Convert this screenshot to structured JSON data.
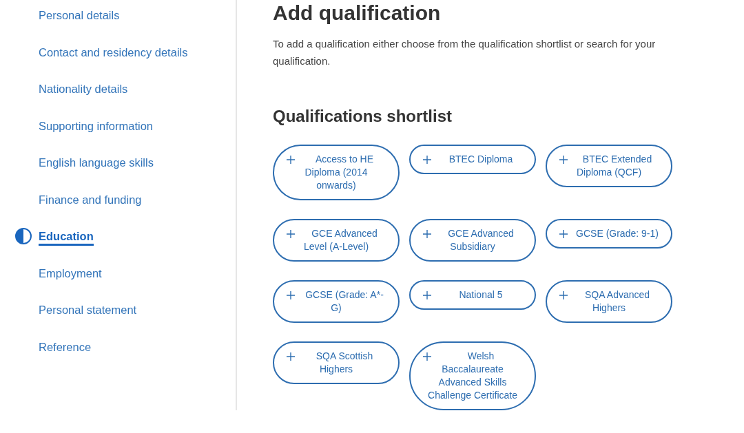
{
  "sidebar": {
    "items": [
      {
        "label": "Personal details",
        "selected": false
      },
      {
        "label": "Contact and residency details",
        "selected": false
      },
      {
        "label": "Nationality details",
        "selected": false
      },
      {
        "label": "Supporting information",
        "selected": false
      },
      {
        "label": "English language skills",
        "selected": false
      },
      {
        "label": "Finance and funding",
        "selected": false
      },
      {
        "label": "Education",
        "selected": true
      },
      {
        "label": "Employment",
        "selected": false
      },
      {
        "label": "Personal statement",
        "selected": false
      },
      {
        "label": "Reference",
        "selected": false
      }
    ]
  },
  "main": {
    "title": "Add qualification",
    "intro": "To add a qualification either choose from the qualification shortlist or search for your qualification.",
    "shortlist": {
      "heading": "Qualifications shortlist",
      "items": [
        "Access to HE Diploma (2014 onwards)",
        "BTEC Diploma",
        "BTEC Extended Diploma (QCF)",
        "GCE Advanced Level (A-Level)",
        "GCE Advanced Subsidiary",
        "GCSE (Grade: 9-1)",
        "GCSE (Grade: A*-G)",
        "National 5",
        "SQA Advanced Highers",
        "SQA Scottish Highers",
        "Welsh Baccalaureate Advanced Skills Challenge Certificate"
      ]
    }
  }
}
